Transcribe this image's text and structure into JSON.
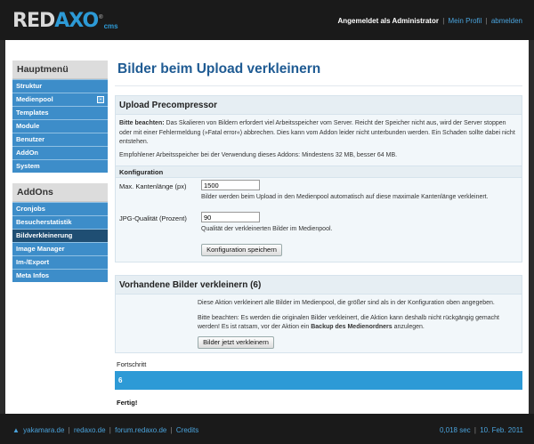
{
  "header": {
    "logo_text_a": "RED",
    "logo_text_x": "AXO",
    "logo_cms": "cms",
    "logo_reg": "®",
    "logged_in_text": "Angemeldet als Administrator",
    "profile_link": "Mein Profil",
    "logout_link": "abmelden",
    "separator": "|"
  },
  "sidebar": {
    "main_title": "Hauptmenü",
    "main_items": [
      {
        "label": "Struktur"
      },
      {
        "label": "Medienpool"
      },
      {
        "label": "Templates"
      },
      {
        "label": "Module"
      },
      {
        "label": "Benutzer"
      },
      {
        "label": "AddOn"
      },
      {
        "label": "System"
      }
    ],
    "addons_title": "AddOns",
    "addon_items": [
      {
        "label": "Cronjobs"
      },
      {
        "label": "Besucherstatistik"
      },
      {
        "label": "Bildverkleinerung"
      },
      {
        "label": "Image Manager"
      },
      {
        "label": "Im-/Export"
      },
      {
        "label": "Meta Infos"
      }
    ]
  },
  "main": {
    "page_title": "Bilder beim Upload verkleinern",
    "precompressor": {
      "title": "Upload Precompressor",
      "notice_bold": "Bitte beachten:",
      "notice_text": " Das Skalieren von Bildern erfordert viel Arbeitsspeicher vom Server. Reicht der Speicher nicht aus, wird der Server stoppen oder mit einer Fehlermeldung (»Fatal error«) abbrechen. Dies kann vom Addon leider nicht unterbunden werden. Ein Schaden sollte dabei nicht entstehen.",
      "memory_text": "Empfohlener Arbeitsspeicher bei der Verwendung dieses Addons: Mindestens 32 MB, besser 64 MB.",
      "config_title": "Konfiguration",
      "max_edge_label": "Max. Kantenlänge (px)",
      "max_edge_value": "1500",
      "max_edge_hint": "Bilder werden beim Upload in den Medienpool automatisch auf diese maximale Kantenlänge verkleinert.",
      "jpg_label": "JPG-Qualität (Prozent)",
      "jpg_value": "90",
      "jpg_hint": "Qualität der verkleinerten Bilder im Medienpool.",
      "save_button": "Konfiguration speichern"
    },
    "existing": {
      "title": "Vorhandene Bilder verkleinern (6)",
      "desc": "Diese Aktion verkleinert alle Bilder im Medienpool, die größer sind als in der Konfiguration oben angegeben.",
      "warn_text": "Bitte beachten: Es werden die originalen Bilder verkleinert, die Aktion kann deshalb nicht rückgängig gemacht werden! Es ist ratsam, vor der Aktion ein ",
      "warn_bold": "Backup des Medienordners",
      "warn_end": " anzulegen.",
      "button": "Bilder jetzt verkleinern"
    },
    "progress": {
      "label": "Fortschritt",
      "value": "6",
      "fraction": 1.0
    },
    "done_text": "Fertig!"
  },
  "footer": {
    "arrow": "▲",
    "links": [
      "yakamara.de",
      "redaxo.de",
      "forum.redaxo.de",
      "Credits"
    ],
    "time": "0,018 sec",
    "date": "10. Feb. 2011",
    "separator": "|"
  },
  "colors": {
    "accent": "#2d9ad6",
    "nav_blue": "#3d8dc9",
    "nav_active": "#1f4e73",
    "title_blue": "#1f5b93"
  }
}
